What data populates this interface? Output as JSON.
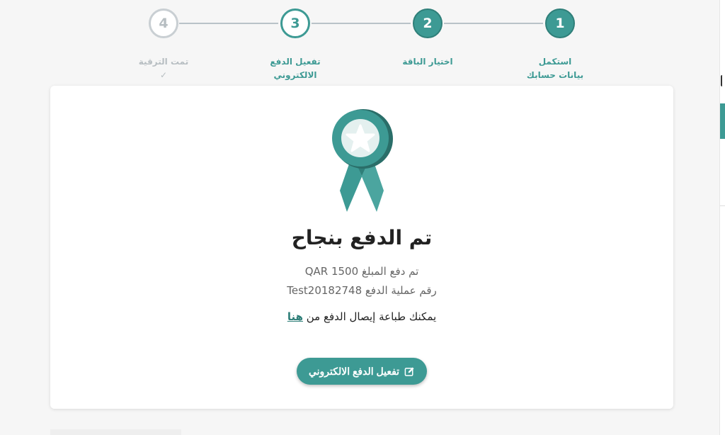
{
  "stepper": {
    "steps": [
      {
        "number": "1",
        "label_line1": "استكمل",
        "label_line2": "بيانات حسابك",
        "state": "completed"
      },
      {
        "number": "2",
        "label_line1": "اختيار الباقة",
        "label_line2": "",
        "state": "completed"
      },
      {
        "number": "3",
        "label_line1": "تفعيل الدفع",
        "label_line2": "الالكتروني",
        "state": "current"
      },
      {
        "number": "4",
        "label_line1": "تمت الترقية",
        "label_line2": "✓",
        "state": "pending"
      }
    ]
  },
  "success": {
    "title": "تم الدفع بنجاح",
    "amount_text": "تم دفع المبلغ QAR 1500",
    "reference_text": "رقم عملية الدفع Test20182748",
    "print_text": "يمكنك طباعة إيصال الدفع من",
    "print_link": "هنا",
    "button_label": "تفعيل الدفع الالكتروني"
  },
  "icons": {
    "medal": "award-ribbon-icon",
    "button": "edit-icon"
  },
  "colors": {
    "accent": "#3d9a94",
    "accent_dark": "#2f7f79",
    "muted": "#b7bec2"
  }
}
